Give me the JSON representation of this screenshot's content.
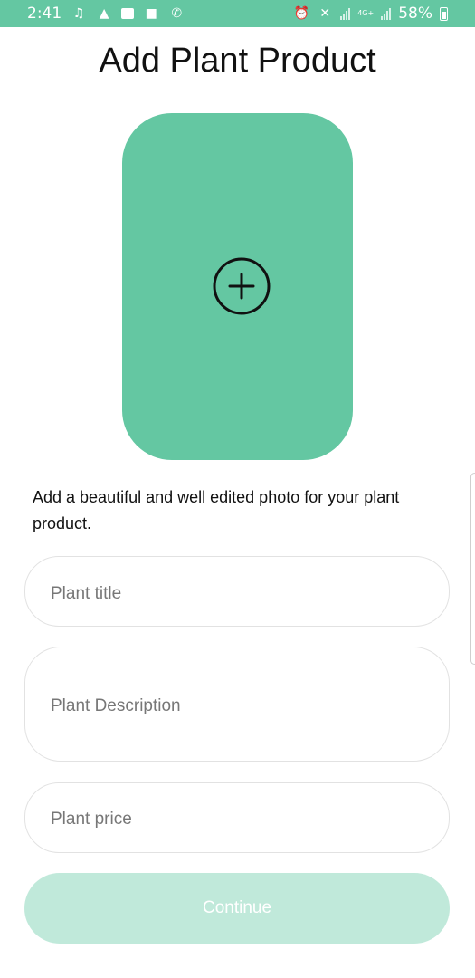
{
  "status_bar": {
    "time": "2:41",
    "battery_percent": "58%",
    "network_label": "4G+",
    "left_icons": [
      "music-icon",
      "warning-icon",
      "mail-icon",
      "video-icon",
      "phone-icon"
    ],
    "right_icons": [
      "alarm-icon",
      "mute-icon",
      "signal-icon",
      "signal-icon",
      "battery-icon"
    ],
    "background_color": "#64c7a2"
  },
  "page": {
    "title": "Add Plant Product"
  },
  "photo_picker": {
    "icon": "add-circle-icon",
    "color": "#64c7a2",
    "hint": "Add a beautiful and well edited photo for your plant product."
  },
  "form": {
    "title_placeholder": "Plant title",
    "description_placeholder": "Plant Description",
    "price_placeholder": "Plant price",
    "continue_label": "Continue",
    "continue_color": "#c0e9da"
  }
}
